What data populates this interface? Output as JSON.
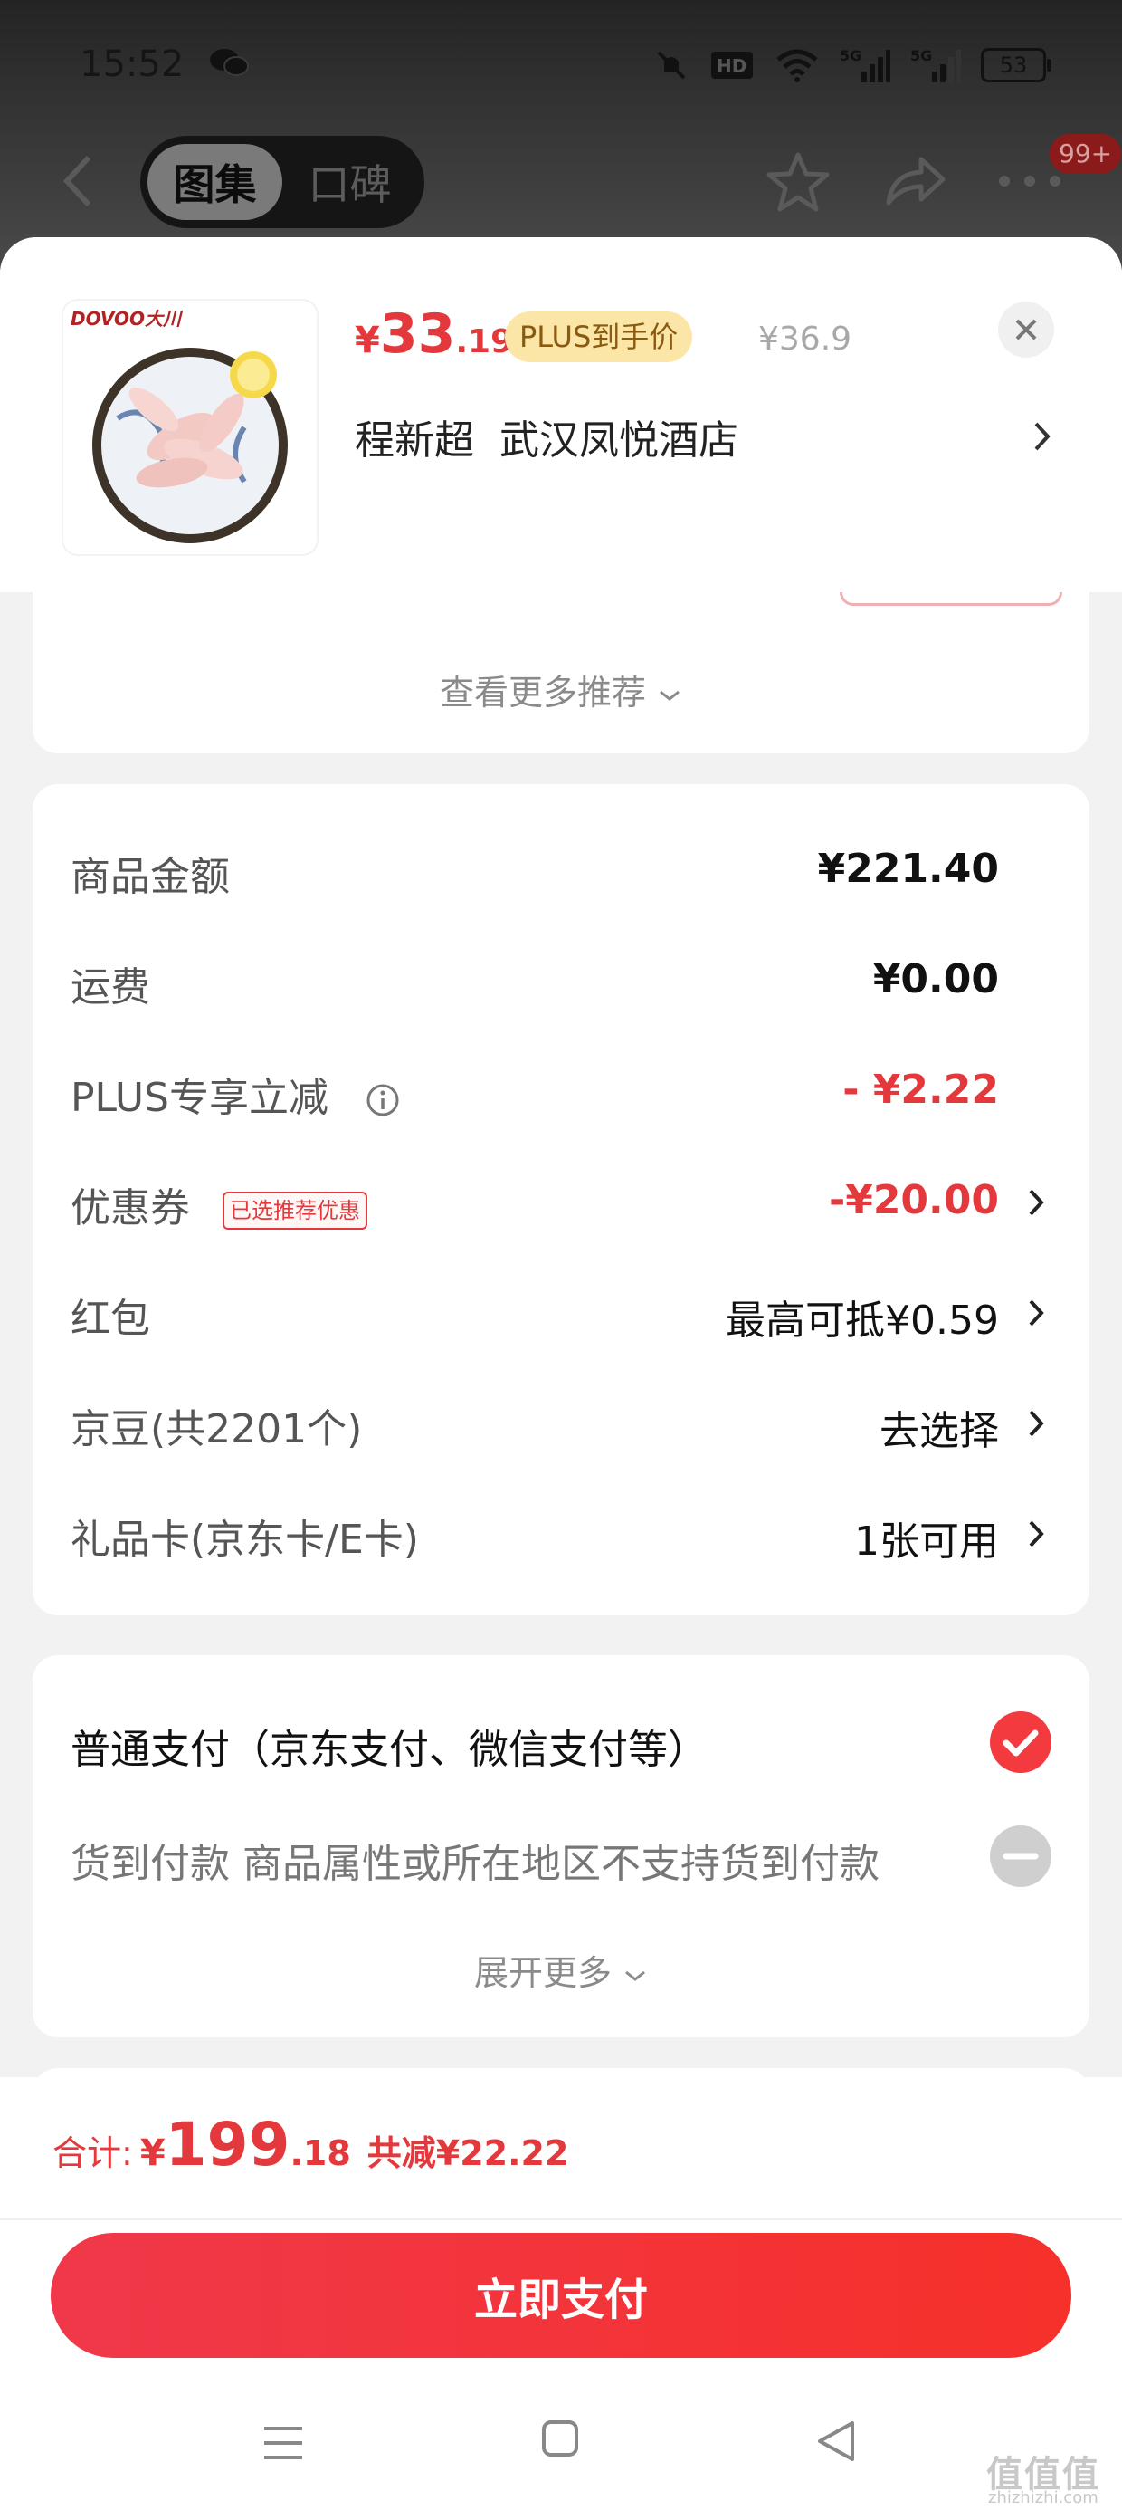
{
  "status": {
    "time": "15:52",
    "battery": "53",
    "hd_label": "HD",
    "net_label": "5G"
  },
  "nav": {
    "tab_gallery": "图集",
    "tab_reviews": "口碑",
    "badge": "99+"
  },
  "product": {
    "price_yen": "¥",
    "price_int": "33",
    "price_dec": ".19",
    "plus_tag": "PLUS到手价",
    "original_price": "¥36.9",
    "store": "程新超  武汉凤悦酒店",
    "thumb_brand": "DOVOO大川"
  },
  "recs": {
    "more_label": "查看更多推荐"
  },
  "amounts": {
    "rows": [
      {
        "label": "商品金额",
        "value": "¥221.40"
      },
      {
        "label": "运费",
        "value": "¥0.00"
      },
      {
        "label": "PLUS专享立减",
        "value": "- ¥2.22"
      },
      {
        "label": "优惠券",
        "tag": "已选推荐优惠",
        "value": "-¥20.00"
      },
      {
        "label": "红包",
        "value": "最高可抵¥0.59"
      },
      {
        "label": "京豆(共2201个)",
        "value": "去选择"
      },
      {
        "label": "礼品卡(京东卡/E卡)",
        "value": "1张可用"
      }
    ]
  },
  "payment": {
    "normal": "普通支付（京东支付、微信支付等）",
    "cod": "货到付款 商品属性或所在地区不支持货到付款",
    "expand_more": "展开更多"
  },
  "bottom": {
    "total_label": "合计:",
    "total_yen": "¥",
    "total_int": "199",
    "total_dec": ".18",
    "saved": "共减¥22.22",
    "pay_button": "立即支付"
  },
  "watermark": {
    "text": "值值值",
    "sub": "zhizhizhi.com"
  },
  "colors": {
    "accent": "#e4393c",
    "plus_bg": "#fbe6a8",
    "button_start": "#f0384a",
    "button_end": "#f6302a"
  }
}
